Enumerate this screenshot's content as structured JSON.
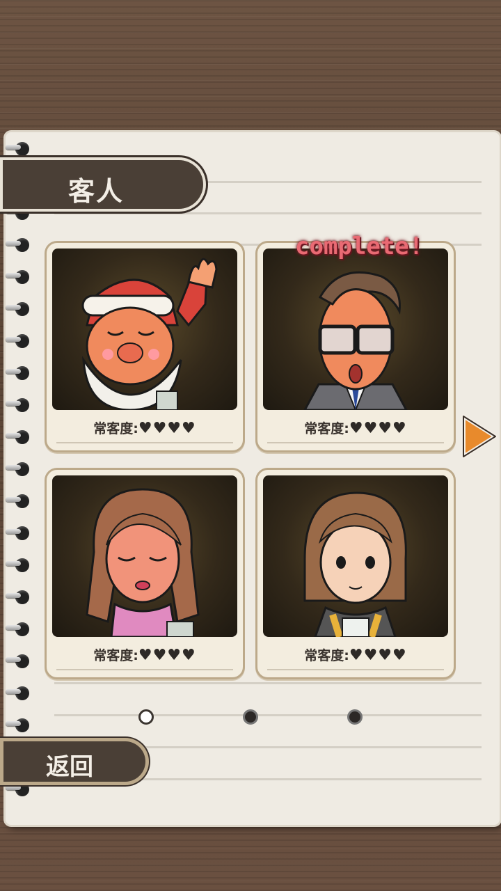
{
  "header": {
    "title": "客人"
  },
  "customers": [
    {
      "name": "santa",
      "label": "常客度:",
      "hearts": "♥♥♥♥",
      "complete": ""
    },
    {
      "name": "glasses-man",
      "label": "常客度:",
      "hearts": "♥♥♥♥",
      "complete": "complete!"
    },
    {
      "name": "woman-wavy-hair",
      "label": "常客度:",
      "hearts": "♥♥♥♥",
      "complete": ""
    },
    {
      "name": "girl-bob-hair",
      "label": "常客度:",
      "hearts": "♥♥♥♥",
      "complete": ""
    }
  ],
  "pagination": {
    "pages": 3,
    "current": 1
  },
  "footer": {
    "back_label": "返回"
  },
  "icons": {
    "next": "play-right-arrow-icon"
  },
  "colors": {
    "accent_orange": "#e88a2c",
    "complete_pink": "#e96a73",
    "tab_brown": "#4a3f36"
  }
}
